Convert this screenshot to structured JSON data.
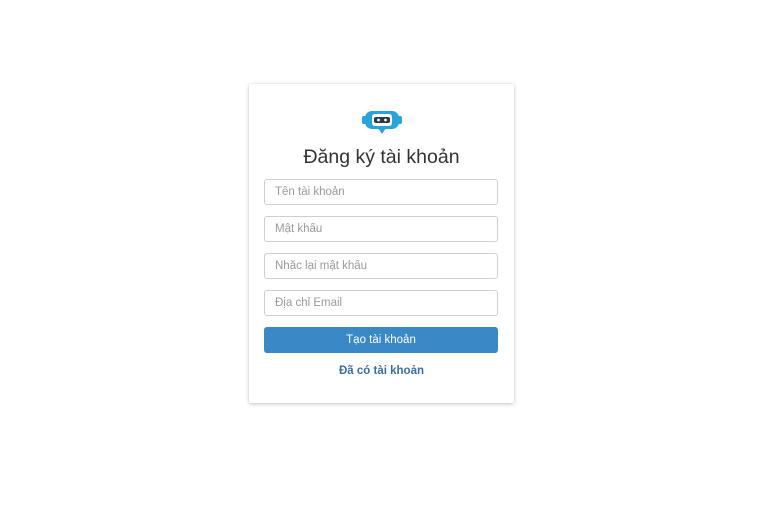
{
  "form": {
    "logo_icon": "robot-chat-logo-icon",
    "title": "Đăng ký tài khoản",
    "username_placeholder": "Tên tài khoản",
    "password_placeholder": "Mật khẩu",
    "confirm_password_placeholder": "Nhắc lại mật khẩu",
    "email_placeholder": "Địa chỉ Email",
    "submit_label": "Tạo tài khoản",
    "login_link": "Đã có tài khoản"
  },
  "colors": {
    "accent": "#3b88c7",
    "logo": "#29a3dc",
    "link": "#3b6ea5"
  }
}
